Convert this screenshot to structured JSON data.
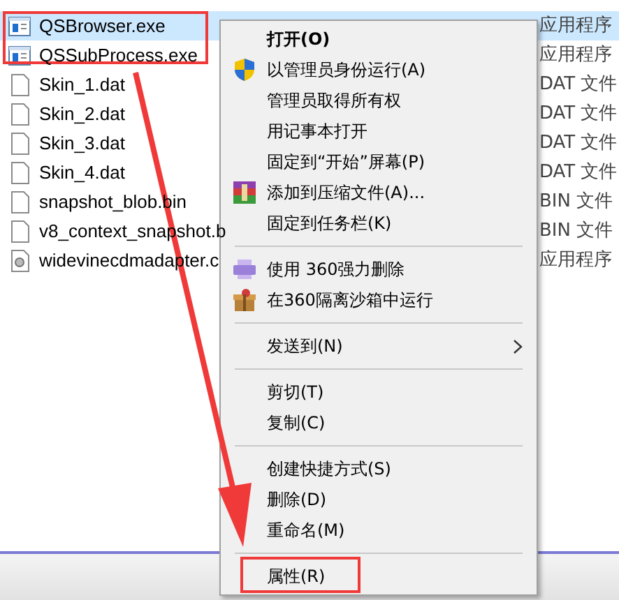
{
  "files": [
    {
      "name": "QSBrowser.exe",
      "type": "应用程序",
      "kind": "exe",
      "selected": true
    },
    {
      "name": "QSSubProcess.exe",
      "type": "应用程序",
      "kind": "exe",
      "selected": false
    },
    {
      "name": "Skin_1.dat",
      "type": "DAT 文件",
      "kind": "doc",
      "selected": false
    },
    {
      "name": "Skin_2.dat",
      "type": "DAT 文件",
      "kind": "doc",
      "selected": false
    },
    {
      "name": "Skin_3.dat",
      "type": "DAT 文件",
      "kind": "doc",
      "selected": false
    },
    {
      "name": "Skin_4.dat",
      "type": "DAT 文件",
      "kind": "doc",
      "selected": false
    },
    {
      "name": "snapshot_blob.bin",
      "type": "BIN 文件",
      "kind": "doc",
      "selected": false
    },
    {
      "name": "v8_context_snapshot.b",
      "type": "BIN 文件",
      "kind": "doc",
      "selected": false
    },
    {
      "name": "widevinecdmadapter.c",
      "type": "应用程序",
      "kind": "dll",
      "selected": false
    }
  ],
  "context_menu": [
    {
      "kind": "plain",
      "label": "打开(O)",
      "default": true
    },
    {
      "kind": "shield",
      "label": "以管理员身份运行(A)"
    },
    {
      "kind": "plain",
      "label": "管理员取得所有权"
    },
    {
      "kind": "plain",
      "label": "用记事本打开"
    },
    {
      "kind": "plain",
      "label": "固定到“开始”屏幕(P)"
    },
    {
      "kind": "archive",
      "label": "添加到压缩文件(A)..."
    },
    {
      "kind": "plain",
      "label": "固定到任务栏(K)"
    },
    {
      "kind": "separator"
    },
    {
      "kind": "shredder",
      "label": "使用 360强力删除"
    },
    {
      "kind": "box",
      "label": "在360隔离沙箱中运行"
    },
    {
      "kind": "separator"
    },
    {
      "kind": "plain",
      "label": "发送到(N)",
      "submenu": true
    },
    {
      "kind": "separator"
    },
    {
      "kind": "plain",
      "label": "剪切(T)"
    },
    {
      "kind": "plain",
      "label": "复制(C)"
    },
    {
      "kind": "separator"
    },
    {
      "kind": "plain",
      "label": "创建快捷方式(S)"
    },
    {
      "kind": "plain",
      "label": "删除(D)"
    },
    {
      "kind": "plain",
      "label": "重命名(M)"
    },
    {
      "kind": "separator"
    },
    {
      "kind": "plain",
      "label": "属性(R)"
    }
  ]
}
